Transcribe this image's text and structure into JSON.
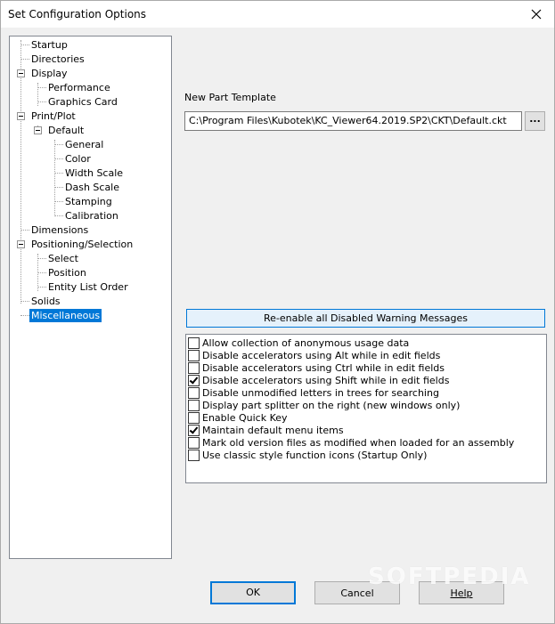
{
  "window": {
    "title": "Set Configuration Options"
  },
  "tree": {
    "items": [
      {
        "label": "Startup",
        "selected": false
      },
      {
        "label": "Directories",
        "selected": false
      },
      {
        "label": "Display",
        "selected": false
      },
      {
        "label": "Performance",
        "selected": false
      },
      {
        "label": "Graphics Card",
        "selected": false
      },
      {
        "label": "Print/Plot",
        "selected": false
      },
      {
        "label": "Default",
        "selected": false
      },
      {
        "label": "General",
        "selected": false
      },
      {
        "label": "Color",
        "selected": false
      },
      {
        "label": "Width Scale",
        "selected": false
      },
      {
        "label": "Dash Scale",
        "selected": false
      },
      {
        "label": "Stamping",
        "selected": false
      },
      {
        "label": "Calibration",
        "selected": false
      },
      {
        "label": "Dimensions",
        "selected": false
      },
      {
        "label": "Positioning/Selection",
        "selected": false
      },
      {
        "label": "Select",
        "selected": false
      },
      {
        "label": "Position",
        "selected": false
      },
      {
        "label": "Entity List Order",
        "selected": false
      },
      {
        "label": "Solids",
        "selected": false
      },
      {
        "label": "Miscellaneous",
        "selected": true
      }
    ]
  },
  "template": {
    "label": "New Part Template",
    "path": "C:\\Program Files\\Kubotek\\KC_Viewer64.2019.SP2\\CKT\\Default.ckt",
    "browse_label": "..."
  },
  "reenable_button": "Re-enable all Disabled Warning Messages",
  "options": [
    {
      "label": "Allow collection of anonymous usage data",
      "checked": false
    },
    {
      "label": "Disable accelerators using Alt while in edit fields",
      "checked": false
    },
    {
      "label": "Disable accelerators using Ctrl while in edit fields",
      "checked": false
    },
    {
      "label": "Disable accelerators using Shift while in edit fields",
      "checked": true
    },
    {
      "label": "Disable unmodified letters in trees for searching",
      "checked": false
    },
    {
      "label": "Display part splitter on the right (new windows only)",
      "checked": false
    },
    {
      "label": "Enable Quick Key",
      "checked": false
    },
    {
      "label": "Maintain default menu items",
      "checked": true
    },
    {
      "label": "Mark old version files as modified when loaded for an assembly",
      "checked": false
    },
    {
      "label": "Use classic style function icons (Startup Only)",
      "checked": false
    }
  ],
  "buttons": {
    "ok": "OK",
    "cancel": "Cancel",
    "help": "Help"
  },
  "watermark": "SOFTPEDIA",
  "colors": {
    "selection": "#0078d7",
    "button_highlight": "#e5f1fb"
  }
}
